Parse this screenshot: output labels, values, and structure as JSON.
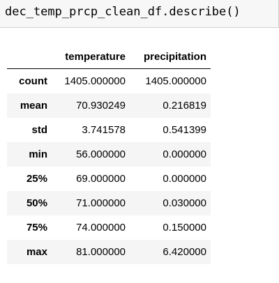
{
  "code_cell": {
    "source": "dec_temp_prcp_clean_df.describe()"
  },
  "table": {
    "columns": [
      "temperature",
      "precipitation"
    ],
    "rows": [
      {
        "label": "count",
        "values": [
          "1405.000000",
          "1405.000000"
        ]
      },
      {
        "label": "mean",
        "values": [
          "70.930249",
          "0.216819"
        ]
      },
      {
        "label": "std",
        "values": [
          "3.741578",
          "0.541399"
        ]
      },
      {
        "label": "min",
        "values": [
          "56.000000",
          "0.000000"
        ]
      },
      {
        "label": "25%",
        "values": [
          "69.000000",
          "0.000000"
        ]
      },
      {
        "label": "50%",
        "values": [
          "71.000000",
          "0.030000"
        ]
      },
      {
        "label": "75%",
        "values": [
          "74.000000",
          "0.150000"
        ]
      },
      {
        "label": "max",
        "values": [
          "81.000000",
          "6.420000"
        ]
      }
    ]
  }
}
